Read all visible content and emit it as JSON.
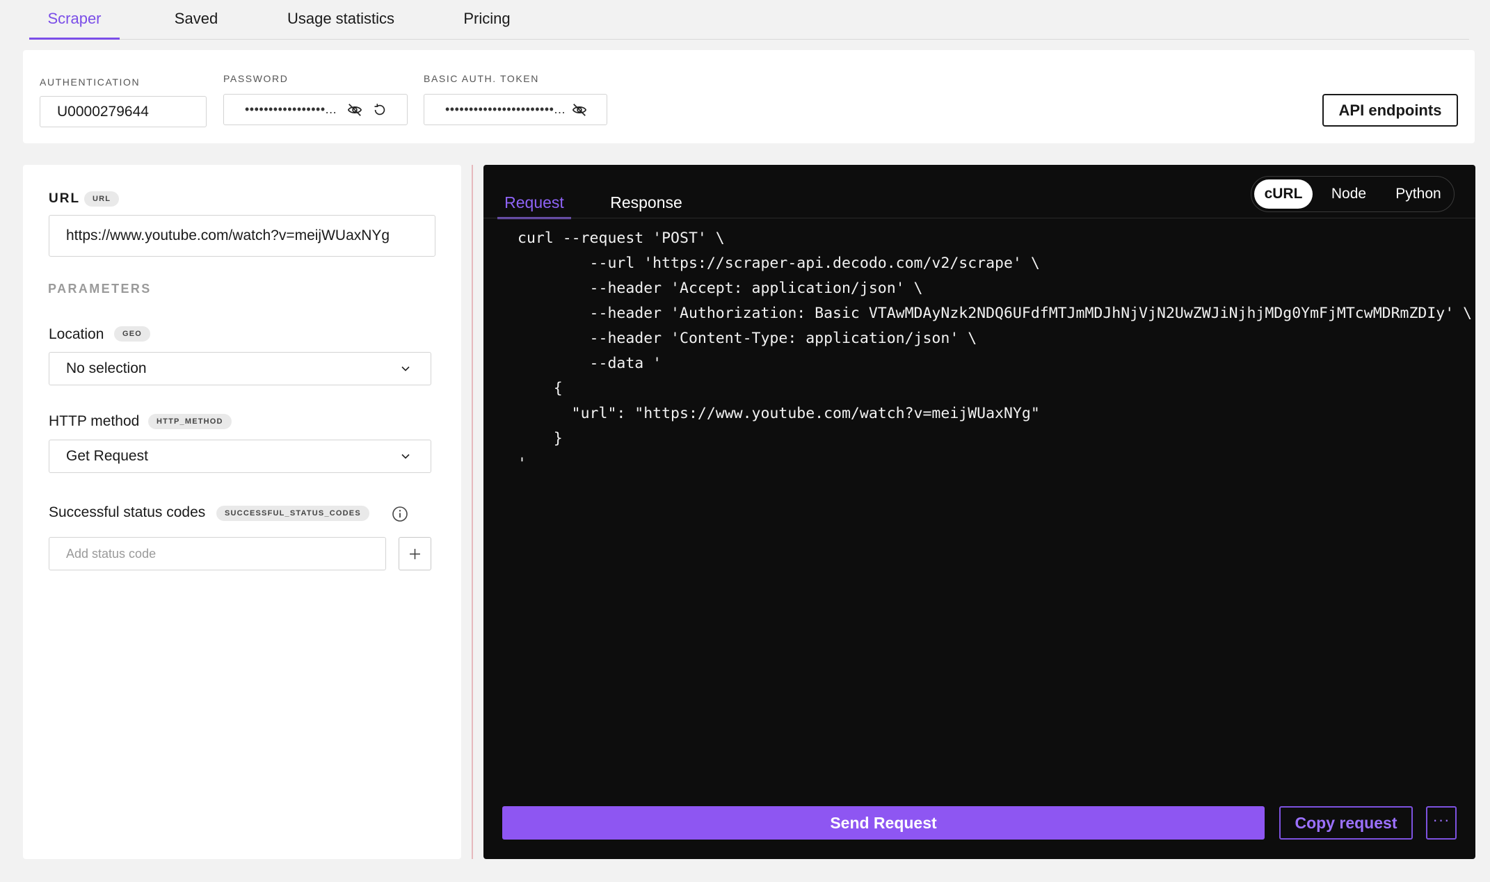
{
  "top_tabs": [
    {
      "label": "Scraper",
      "active": true
    },
    {
      "label": "Saved",
      "active": false
    },
    {
      "label": "Usage statistics",
      "active": false
    },
    {
      "label": "Pricing",
      "active": false
    }
  ],
  "auth": {
    "authentication_label": "AUTHENTICATION",
    "authentication_value": "U0000279644",
    "password_label": "PASSWORD",
    "password_value": "•••••••••••••••••...",
    "token_label": "BASIC AUTH. TOKEN",
    "token_value": "•••••••••••••••••••••••...",
    "api_endpoints_label": "API endpoints"
  },
  "params": {
    "url_label": "URL",
    "url_chip": "URL",
    "url_value": "https://www.youtube.com/watch?v=meijWUaxNYg",
    "parameters_heading": "PARAMETERS",
    "location_label": "Location",
    "location_chip": "GEO",
    "location_value": "No selection",
    "http_method_label": "HTTP method",
    "http_method_chip": "HTTP_METHOD",
    "http_method_value": "Get Request",
    "status_codes_label": "Successful status codes",
    "status_codes_chip": "SUCCESSFUL_STATUS_CODES",
    "status_code_placeholder": "Add status code"
  },
  "code_panel": {
    "tabs": [
      {
        "label": "Request",
        "active": true
      },
      {
        "label": "Response",
        "active": false
      }
    ],
    "languages": [
      {
        "label": "cURL",
        "active": true
      },
      {
        "label": "Node",
        "active": false
      },
      {
        "label": "Python",
        "active": false
      }
    ],
    "code_lines": [
      "curl --request 'POST' \\",
      "        --url 'https://scraper-api.decodo.com/v2/scrape' \\",
      "        --header 'Accept: application/json' \\",
      "        --header 'Authorization: Basic VTAwMDAyNzk2NDQ6UFdfMTJmMDJhNjVjN2UwZWJiNjhjMDg0YmFjMTcwMDRmZDIy' \\",
      "        --header 'Content-Type: application/json' \\",
      "        --data '",
      "    {",
      "      \"url\": \"https://www.youtube.com/watch?v=meijWUaxNYg\"",
      "    }",
      "'"
    ],
    "send_label": "Send Request",
    "copy_label": "Copy request",
    "more_label": "···"
  }
}
